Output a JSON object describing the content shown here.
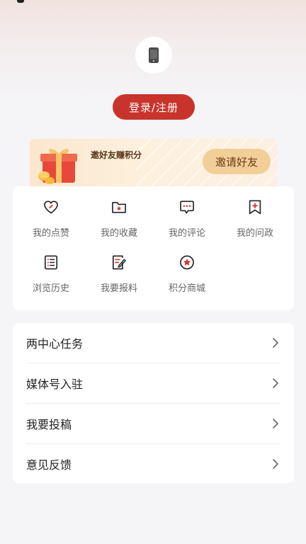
{
  "profile": {
    "avatar_icon": "phone-icon",
    "login_label": "登录/注册"
  },
  "invite": {
    "title": "邀好友赚积分",
    "button_label": "邀请好友",
    "gift_icon": "gift-box-icon"
  },
  "shortcuts": [
    {
      "label": "我的点赞",
      "icon": "heart-icon"
    },
    {
      "label": "我的收藏",
      "icon": "folder-star-icon"
    },
    {
      "label": "我的评论",
      "icon": "comment-icon"
    },
    {
      "label": "我的问政",
      "icon": "bookmark-plus-icon"
    },
    {
      "label": "浏览历史",
      "icon": "history-list-icon"
    },
    {
      "label": "我要报料",
      "icon": "edit-report-icon"
    },
    {
      "label": "积分商城",
      "icon": "star-circle-icon"
    }
  ],
  "menu": [
    {
      "label": "两中心任务"
    },
    {
      "label": "媒体号入驻"
    },
    {
      "label": "我要投稿"
    },
    {
      "label": "意见反馈"
    }
  ],
  "colors": {
    "accent": "#c8342c",
    "invite_button": "#f2cf98",
    "icon_stroke": "#222222",
    "icon_red": "#d8322d"
  }
}
